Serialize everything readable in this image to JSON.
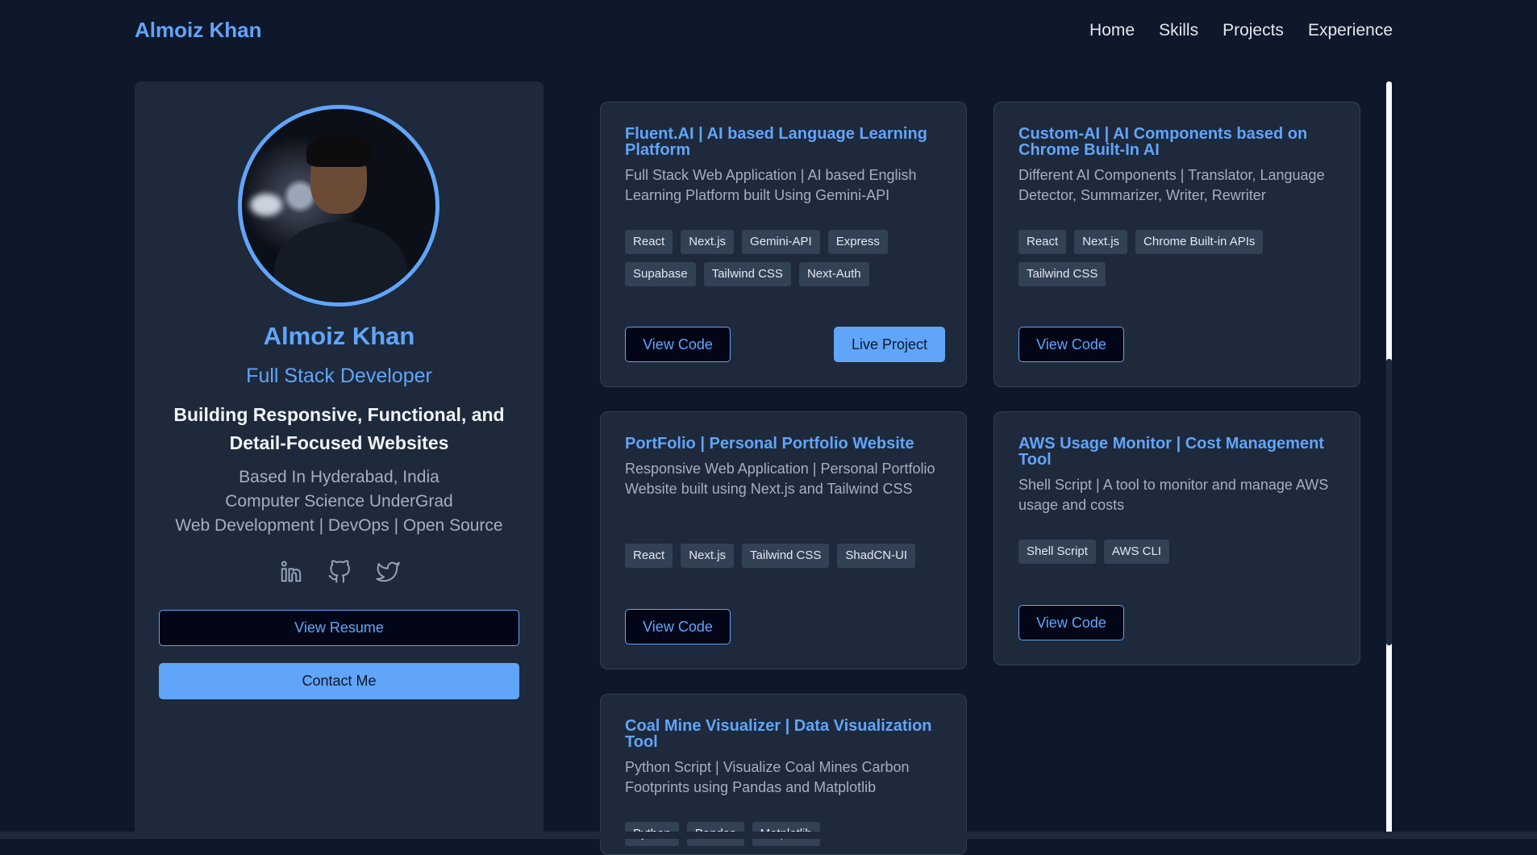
{
  "nav": {
    "brand": "Almoiz Khan",
    "links": [
      "Home",
      "Skills",
      "Projects",
      "Experience"
    ]
  },
  "profile": {
    "name": "Almoiz Khan",
    "role": "Full Stack Developer",
    "tagline": "Building Responsive, Functional, and Detail-Focused Websites",
    "info": [
      "Based In Hyderabad, India",
      "Computer Science UnderGrad",
      "Web Development | DevOps | Open Source"
    ],
    "socials": [
      "linkedin-icon",
      "github-icon",
      "twitter-icon"
    ],
    "resume_label": "View Resume",
    "contact_label": "Contact Me"
  },
  "projects": [
    {
      "title": "Fluent.AI | AI based Language Learning Platform",
      "description": "Full Stack Web Application | AI based English Learning Platform built Using Gemini-API",
      "tags": [
        "React",
        "Next.js",
        "Gemini-API",
        "Express",
        "Supabase",
        "Tailwind CSS",
        "Next-Auth"
      ],
      "code_label": "View Code",
      "live_label": "Live Project"
    },
    {
      "title": "Custom-AI | AI Components based on Chrome Built-In AI",
      "description": "Different AI Components | Translator, Language Detector, Summarizer, Writer, Rewriter",
      "tags": [
        "React",
        "Next.js",
        "Chrome Built-in APIs",
        "Tailwind CSS"
      ],
      "code_label": "View Code"
    },
    {
      "title": "PortFolio | Personal Portfolio Website",
      "description": "Responsive Web Application | Personal Portfolio Website built using Next.js and Tailwind CSS",
      "tags": [
        "React",
        "Next.js",
        "Tailwind CSS",
        "ShadCN-UI"
      ],
      "code_label": "View Code"
    },
    {
      "title": "AWS Usage Monitor | Cost Management Tool",
      "description": "Shell Script | A tool to monitor and manage AWS usage and costs",
      "tags": [
        "Shell Script",
        "AWS CLI"
      ],
      "code_label": "View Code"
    },
    {
      "title": "Coal Mine Visualizer | Data Visualization Tool",
      "description": "Python Script | Visualize Coal Mines Carbon Footprints using Pandas and Matplotlib",
      "tags": [
        "Python",
        "Pandas",
        "Matplotlib"
      ]
    }
  ],
  "colors": {
    "background": "#0f172a",
    "card": "#1e293b",
    "accent": "#60a5fa"
  }
}
